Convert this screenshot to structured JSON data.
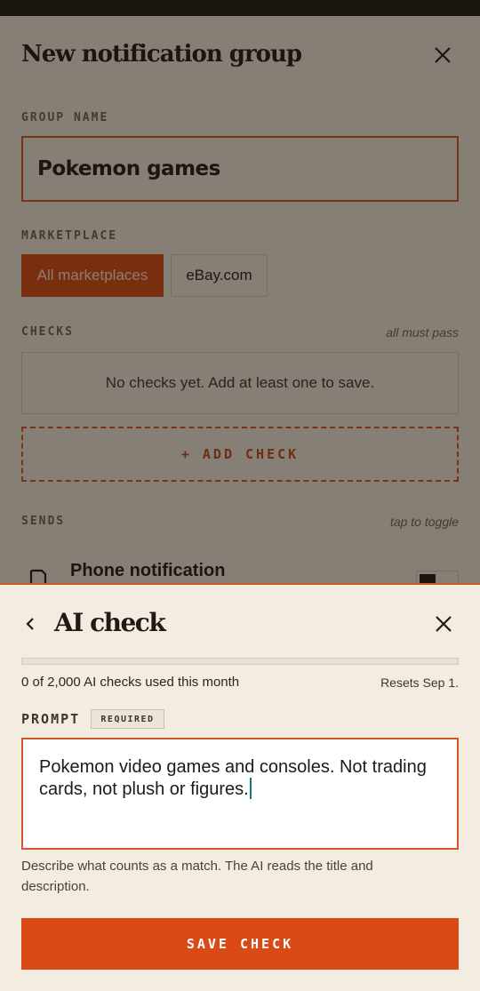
{
  "background_page": {
    "title": "New notification group",
    "group_name": {
      "label": "GROUP NAME",
      "value": "Pokemon games"
    },
    "marketplace": {
      "label": "MARKETPLACE",
      "options": [
        "All marketplaces",
        "eBay.com"
      ],
      "selected": "All marketplaces"
    },
    "checks": {
      "label": "CHECKS",
      "note": "all must pass",
      "empty_text": "No checks yet. Add at least one to save.",
      "add_label": "+ ADD CHECK"
    },
    "sends": {
      "label": "SENDS",
      "note": "tap to toggle",
      "items": [
        {
          "label": "Phone notification",
          "icon": "phone-notification-icon"
        }
      ]
    }
  },
  "sheet": {
    "title": "AI check",
    "usage": {
      "used": 0,
      "limit": 2000,
      "fraction": 0,
      "text": "0 of 2,000 AI checks used this month",
      "resets": "Resets Sep 1."
    },
    "prompt": {
      "label": "PROMPT",
      "badge": "REQUIRED",
      "value": "Pokemon video games and consoles. Not trading cards, not plush or figures."
    },
    "help": "Describe what counts as a match. The AI reads the title and description.",
    "save_label": "SAVE CHECK"
  },
  "colors": {
    "accent": "#d94a17",
    "background": "#f3ece0",
    "text": "#1f1a16",
    "caret": "#0f7a78"
  }
}
